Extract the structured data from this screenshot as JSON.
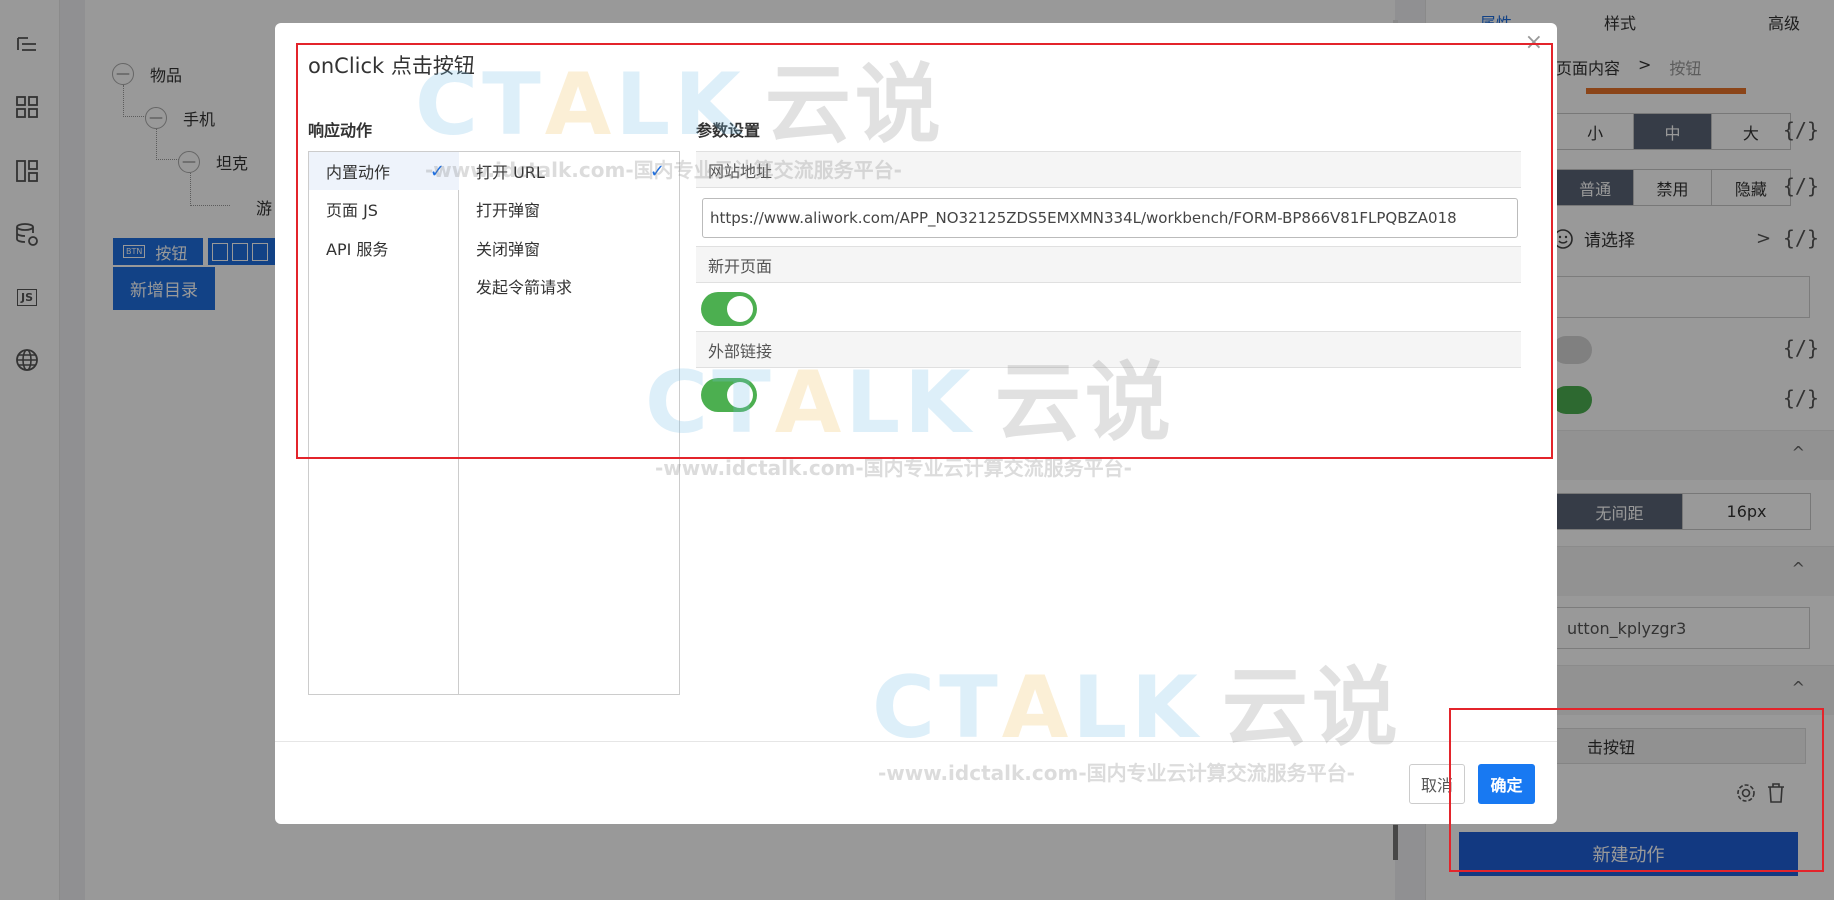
{
  "left_bar": {
    "icons": [
      "outline-icon",
      "components-icon",
      "layout-icon",
      "datasource-icon",
      "js-icon",
      "globe-icon"
    ],
    "js_label": "JS"
  },
  "tree": {
    "n1": "物品",
    "n2": "手机",
    "n3": "坦克",
    "n4": "游",
    "selected_label": "按钮",
    "selected_badge": "BTN",
    "add_button": "新增目录"
  },
  "right_panel": {
    "tabs": [
      "属性",
      "样式",
      "高级"
    ],
    "breadcrumb": [
      "页面内容",
      "按钮"
    ],
    "breadcrumb_sep": ">",
    "size_options": [
      "小",
      "中",
      "大"
    ],
    "state_options": [
      "普通",
      "禁用",
      "隐藏"
    ],
    "code_symbol": "{/}",
    "icon_select": "请选择",
    "icon_select_arrow": ">",
    "spacing_options": [
      "无间距",
      "16px"
    ],
    "field_id": "utton_kplyzgr3",
    "action_item": "击按钮",
    "new_action_button": "新建动作",
    "collapse_glyph": "^"
  },
  "modal": {
    "title": "onClick 点击按钮",
    "close": "×",
    "response_label": "响应动作",
    "param_label": "参数设置",
    "col1_items": [
      "内置动作",
      "页面 JS",
      "API 服务"
    ],
    "col2_items": [
      "打开 URL",
      "打开弹窗",
      "关闭弹窗",
      "发起令箭请求"
    ],
    "check": "✓",
    "website_label": "网站地址",
    "url_value": "https://www.aliwork.com/APP_NO32125ZDS5EMXMN334L/workbench/FORM-BP866V81FLPQBZA018",
    "new_page_label": "新开页面",
    "external_label": "外部链接",
    "new_page_on": true,
    "external_on": true,
    "cancel": "取消",
    "ok": "确定"
  },
  "watermark": {
    "logo_c": "C",
    "logo_t": "T",
    "logo_a": "A",
    "logo_lk": "LK",
    "logo_cn": "云说",
    "subtitle": "-www.idctalk.com-国内专业云计算交流服务平台-"
  },
  "colors": {
    "primary": "#1f6fe0",
    "ok_button": "#1879f2",
    "toggle_on": "#4caf50",
    "highlight_border": "#e3242b",
    "segment_active": "#5a6577"
  }
}
